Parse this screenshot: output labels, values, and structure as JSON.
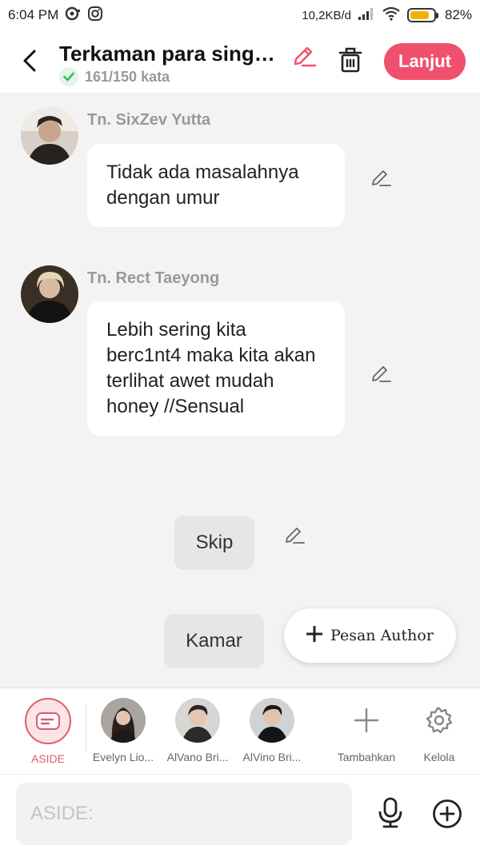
{
  "status_bar": {
    "time": "6:04 PM",
    "net_speed": "10,2KB/d",
    "battery": "82%",
    "battery_level": 0.82
  },
  "header": {
    "title": "Terkaman para singa ...",
    "word_count": "161/150 kata",
    "next_label": "Lanjut",
    "accent": "#f0506e"
  },
  "messages": [
    {
      "sender": "Tn. SixZev Yutta",
      "text": "Tidak ada masalahnya dengan umur"
    },
    {
      "sender": "Tn. Rect Taeyong",
      "text": "Lebih sering kita berc1nt4 maka kita akan terlihat awet mudah honey //Sensual"
    }
  ],
  "actions": {
    "skip_label": "Skip",
    "kamar_label": "Kamar",
    "author_label": "Pesan Author"
  },
  "characters": [
    {
      "name": "ASIDE",
      "color": "#e05a70"
    },
    {
      "name": "Evelyn Lio..."
    },
    {
      "name": "AlVano Bri..."
    },
    {
      "name": "AlVino Bri..."
    }
  ],
  "tools": {
    "add_label": "Tambahkan",
    "manage_label": "Kelola"
  },
  "input": {
    "placeholder": "ASIDE:"
  }
}
